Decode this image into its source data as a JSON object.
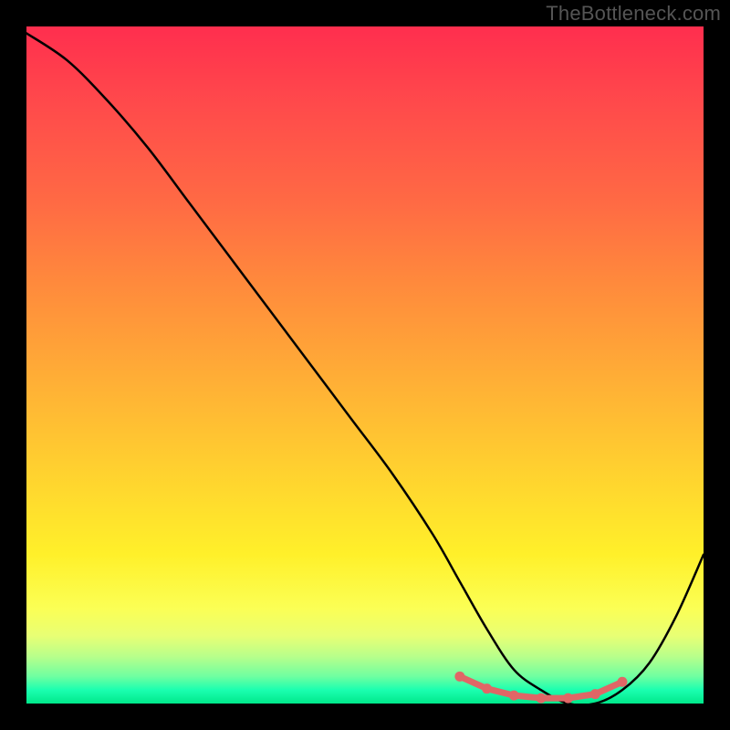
{
  "watermark": "TheBottleneck.com",
  "chart_data": {
    "type": "line",
    "title": "",
    "xlabel": "",
    "ylabel": "",
    "xlim": [
      0,
      100
    ],
    "ylim": [
      0,
      100
    ],
    "series": [
      {
        "name": "bottleneck-curve",
        "x": [
          0,
          6,
          12,
          18,
          24,
          30,
          36,
          42,
          48,
          54,
          60,
          64,
          68,
          72,
          76,
          80,
          84,
          88,
          92,
          96,
          100
        ],
        "values": [
          99,
          95,
          89,
          82,
          74,
          66,
          58,
          50,
          42,
          34,
          25,
          18,
          11,
          5,
          2,
          0,
          0,
          2,
          6,
          13,
          22
        ]
      }
    ],
    "optimal_zone": {
      "marker_color": "#e06666",
      "x": [
        64,
        68,
        72,
        76,
        80,
        84,
        88
      ],
      "values": [
        4.0,
        2.2,
        1.2,
        0.8,
        0.8,
        1.4,
        3.2
      ]
    },
    "gradient_stops": [
      {
        "pos": 0,
        "color": "#ff2e4e"
      },
      {
        "pos": 50,
        "color": "#ffae36"
      },
      {
        "pos": 80,
        "color": "#fff02a"
      },
      {
        "pos": 100,
        "color": "#00e88a"
      }
    ]
  }
}
